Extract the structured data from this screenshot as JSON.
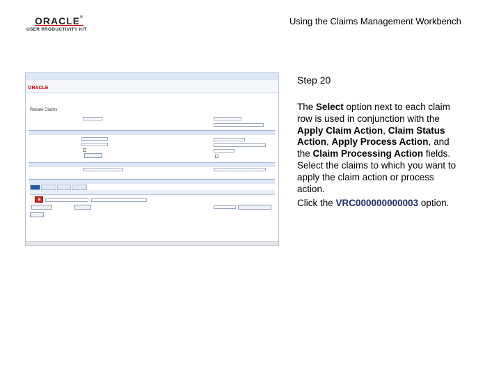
{
  "header": {
    "logo_text": "ORACLE",
    "logo_subtext": "USER PRODUCTIVITY KIT",
    "doc_title": "Using the Claims Management Workbench"
  },
  "screenshot": {
    "app_logo": "ORACLE",
    "page_heading": "Rebate Claims",
    "select_button_color": "#d52b1e"
  },
  "instructions": {
    "step": "Step 20",
    "p1_a": "The ",
    "p1_b": "Select",
    "p1_c": " option next to each claim row is used in conjunction with the ",
    "p1_d": "Apply Claim Action",
    "p1_e": ", ",
    "p1_f": "Claim Status Action",
    "p1_g": ", ",
    "p1_h": "Apply Process Action",
    "p1_i": ", and the ",
    "p1_j": "Claim Processing Action",
    "p1_k": " fields. Select the claims to which you want to apply the claim action or process action.",
    "p2_a": "Click the ",
    "p2_b": "VRC000000000003",
    "p2_c": " option."
  }
}
